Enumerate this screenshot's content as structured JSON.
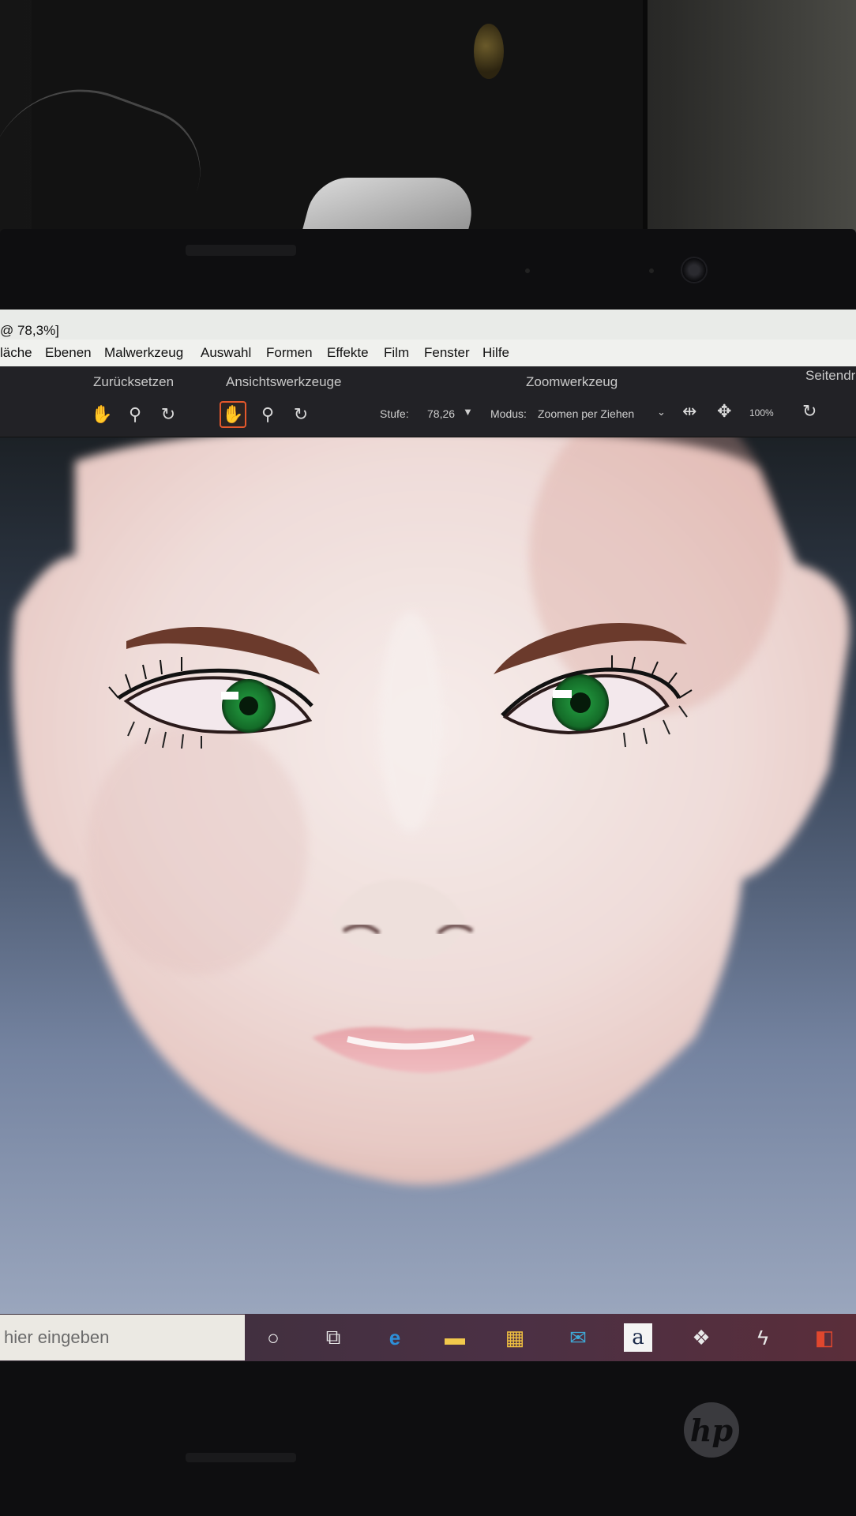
{
  "window": {
    "title_fragment": "@ 78,3%]"
  },
  "menu": {
    "items": [
      "läche",
      "Ebenen",
      "Malwerkzeug",
      "Auswahl",
      "Formen",
      "Effekte",
      "Film",
      "Fenster",
      "Hilfe"
    ]
  },
  "toolbar": {
    "group_reset": "Zurücksetzen",
    "group_view": "Ansichtswerkzeuge",
    "group_zoom": "Zoomwerkzeug",
    "group_page": "Seitendr",
    "level_label": "Stufe:",
    "level_value": "78,26",
    "mode_label": "Modus:",
    "mode_value": "Zoomen per Ziehen",
    "percent_label": "100%"
  },
  "taskbar": {
    "search_placeholder": "hier eingeben",
    "icons": [
      "cortana-circle",
      "task-view",
      "edge",
      "file-explorer",
      "store",
      "mail",
      "amazon",
      "dropbox",
      "app-s",
      "office"
    ]
  },
  "branding": {
    "laptop_logo": "hp"
  },
  "colors": {
    "accent_active_tool": "#e4582c",
    "iris": "#1f8f3a",
    "lips": "#e7a6ab",
    "brows": "#6b3a2c"
  }
}
